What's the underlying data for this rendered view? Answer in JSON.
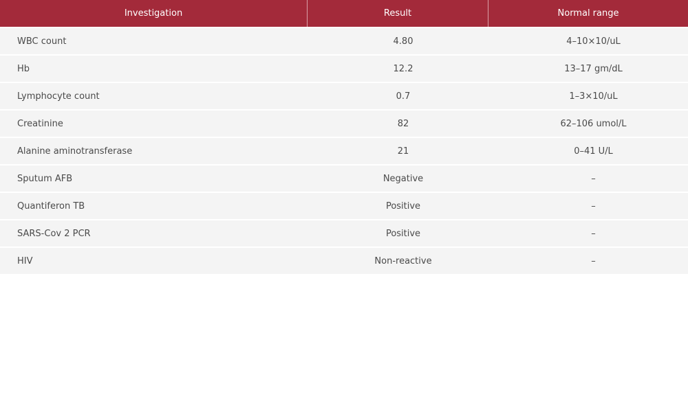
{
  "header": {
    "investigation": "Investigation",
    "result": "Result",
    "normal_range": "Normal range"
  },
  "rows": [
    {
      "investigation": "WBC count",
      "result": "4.80",
      "normal_range": "4–10×10/uL"
    },
    {
      "investigation": "Hb",
      "result": "12.2",
      "normal_range": "13–17 gm/dL"
    },
    {
      "investigation": "Lymphocyte count",
      "result": "0.7",
      "normal_range": "1–3×10/uL"
    },
    {
      "investigation": "Creatinine",
      "result": "82",
      "normal_range": "62–106 umol/L"
    },
    {
      "investigation": "Alanine aminotransferase",
      "result": "21",
      "normal_range": "0–41 U/L"
    },
    {
      "investigation": "Sputum AFB",
      "result": "Negative",
      "normal_range": "–"
    },
    {
      "investigation": "Quantiferon TB",
      "result": "Positive",
      "normal_range": "–"
    },
    {
      "investigation": "SARS-Cov 2 PCR",
      "result": "Positive",
      "normal_range": "–"
    },
    {
      "investigation": "HIV",
      "result": "Non-reactive",
      "normal_range": "–"
    }
  ],
  "colors": {
    "header_bg": "#a32a3a",
    "header_text": "#ffffff",
    "row_bg": "#f4f4f4",
    "row_text": "#4a4a4a"
  }
}
